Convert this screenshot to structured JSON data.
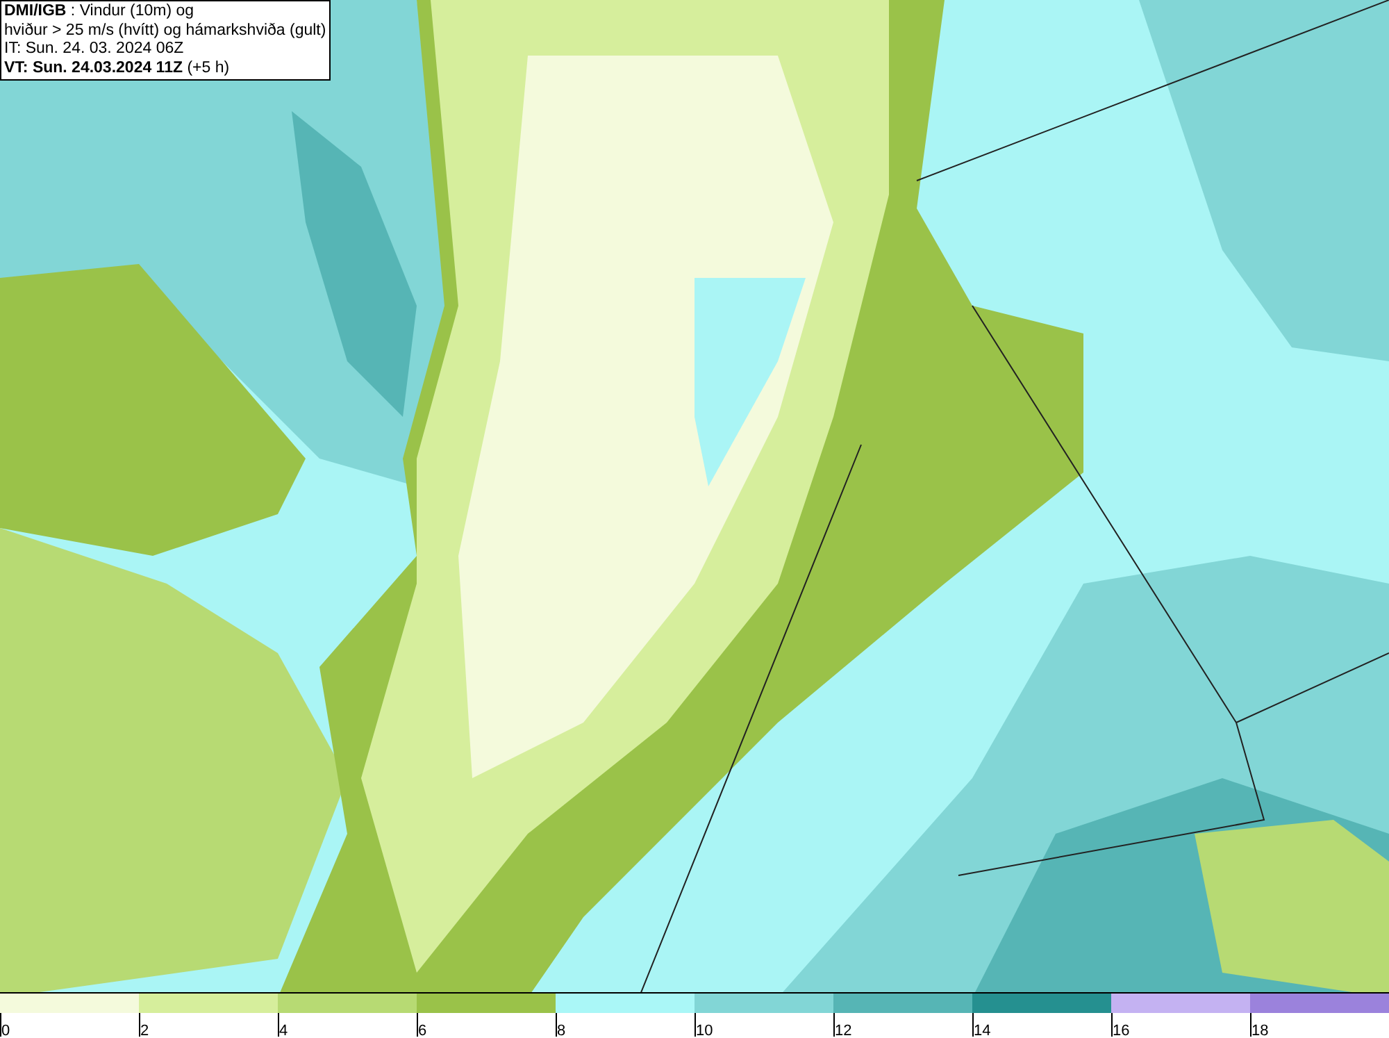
{
  "title_box": {
    "lines": [
      "**DMI/IGB** : Vindur (10m) og",
      "hviður > 25 m/s (hvítt) og hámarkshviða (gult)",
      "IT: Sun. 24. 03. 2024 06Z",
      "**VT: Sun. 24.03.2024 11Z** (+5 h)"
    ]
  },
  "legend": {
    "segments": [
      {
        "color": "#f4fadc"
      },
      {
        "color": "#d6ee9c"
      },
      {
        "color": "#b7da73"
      },
      {
        "color": "#9ac249"
      },
      {
        "color": "#aaf7f7"
      },
      {
        "color": "#82d6d6"
      },
      {
        "color": "#56b5b5"
      },
      {
        "color": "#259090"
      },
      {
        "color": "#c4b2f2"
      },
      {
        "color": "#9b82dc"
      }
    ],
    "ticks": [
      "0",
      "2",
      "4",
      "6",
      "8",
      "10",
      "12",
      "14",
      "16",
      "18"
    ]
  }
}
